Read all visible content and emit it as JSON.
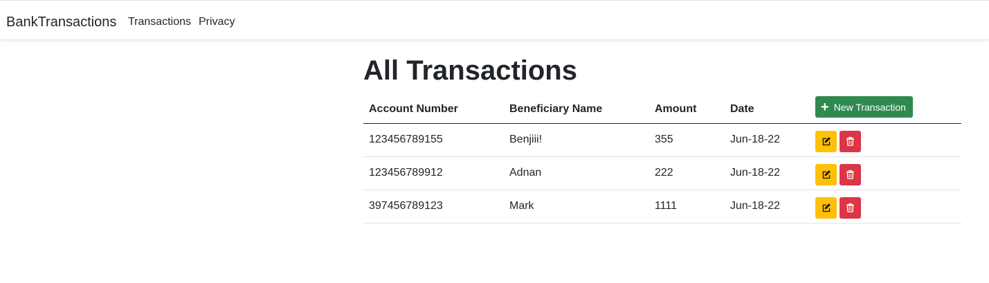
{
  "navbar": {
    "brand": "BankTransactions",
    "links": [
      {
        "label": "Transactions"
      },
      {
        "label": "Privacy"
      }
    ]
  },
  "main": {
    "title": "All Transactions",
    "new_button_label": "New Transaction",
    "table": {
      "headers": [
        "Account Number",
        "Beneficiary Name",
        "Amount",
        "Date"
      ],
      "rows": [
        {
          "account": "123456789155",
          "name": "Benjiii!",
          "amount": "355",
          "date": "Jun-18-22"
        },
        {
          "account": "123456789912",
          "name": "Adnan",
          "amount": "222",
          "date": "Jun-18-22"
        },
        {
          "account": "397456789123",
          "name": "Mark",
          "amount": "1111",
          "date": "Jun-18-22"
        }
      ]
    }
  },
  "icons": {
    "new": "plus-icon",
    "edit": "edit-icon",
    "delete": "trash-icon"
  },
  "colors": {
    "success": "#2f8a4f",
    "warning": "#ffc107",
    "danger": "#dc3545"
  }
}
